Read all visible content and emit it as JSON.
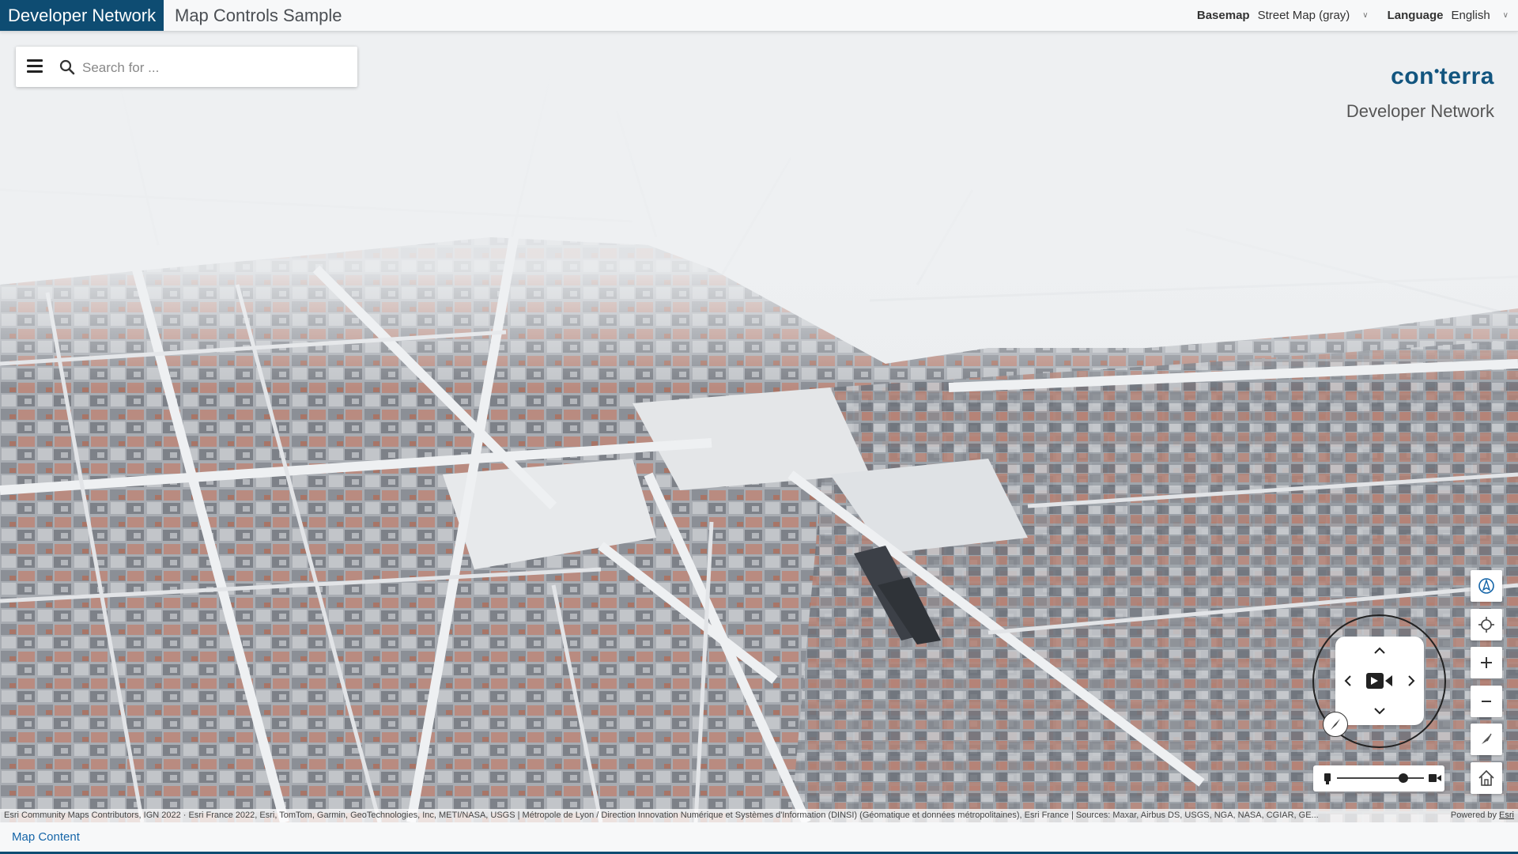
{
  "header": {
    "brand": "Developer Network",
    "title": "Map Controls Sample",
    "basemap_label": "Basemap",
    "basemap_value": "Street Map (gray)",
    "language_label": "Language",
    "language_value": "English"
  },
  "search": {
    "placeholder": "Search for ..."
  },
  "logo": {
    "main_left": "con",
    "main_right": "terra",
    "subtitle": "Developer Network"
  },
  "map": {
    "attribution": "Esri Community Maps Contributors, IGN 2022 · Esri France 2022, Esri, TomTom, Garmin, GeoTechnologies, Inc, METI/NASA, USGS | Métropole de Lyon / Direction Innovation Numérique et Systèmes d'Information (DINSI) (Géomatique et données métropolitaines), Esri France | Sources: Maxar, Airbus DS, USGS, NGA, NASA, CGIAR, GE...",
    "powered_by": "Powered by",
    "powered_by_link": "Esri"
  },
  "footer": {
    "map_content": "Map Content"
  },
  "colors": {
    "brand": "#0e4c72",
    "link": "#1565a8",
    "logo": "#12557f"
  }
}
